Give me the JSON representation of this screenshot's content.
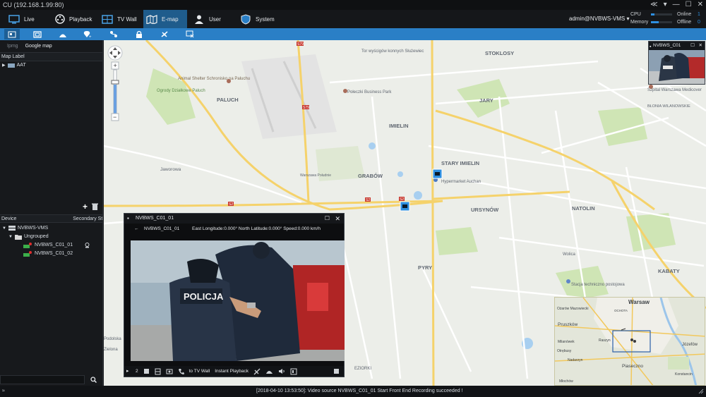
{
  "window": {
    "title": "CU (192.168.1.99:80)",
    "controls": [
      "≪",
      "▾",
      "—",
      "☐",
      "✕"
    ]
  },
  "nav": {
    "items": [
      {
        "label": "Live",
        "icon": "monitor-icon"
      },
      {
        "label": "Playback",
        "icon": "film-reel-icon"
      },
      {
        "label": "TV Wall",
        "icon": "grid-icon"
      },
      {
        "label": "E-map",
        "icon": "map-icon"
      },
      {
        "label": "User",
        "icon": "user-icon"
      },
      {
        "label": "System",
        "icon": "shield-icon"
      }
    ],
    "active": "E-map",
    "user": "admin@NVBWS-VMS ▾",
    "cpu_label": "CPU",
    "memory_label": "Memory",
    "online_label": "Online",
    "offline_label": "Offline",
    "online_count": "1",
    "offline_count": "0",
    "cpu_level": 0.15,
    "memory_level": 0.35
  },
  "toolbar": {
    "tools": [
      "layers-icon",
      "fullscreen-icon",
      "camera-dome-icon",
      "add-location-icon",
      "route-icon",
      "lock-icon",
      "satellite-icon",
      "clear-icon"
    ]
  },
  "left": {
    "tab_inactive": "Ipmg",
    "tab_active": "Google map",
    "map_label_header": "Map Label",
    "map_label_item": "AAT",
    "device_header": "Device",
    "secondary_header": "Secondary St",
    "tree": {
      "root": "NVBWS-VMS",
      "group": "Ungrouped",
      "devices": [
        "NVBWS_C01_01",
        "NVBWS_C01_02"
      ]
    }
  },
  "map": {
    "labels": {
      "stoklosy": "STOKLOSY",
      "jary": "JARY",
      "imielin": "IMIELIN",
      "stary_imielin": "STARY IMIELIN",
      "grabow": "GRABÓW",
      "ursynow": "URSYNÓW",
      "natolin": "NATOLIN",
      "kabaty": "KABATY",
      "paluch": "PALUCH",
      "jaworowa": "Jaworowa",
      "blonia": "BŁONIA WILANOWSKIE",
      "animal_shelter": "Animal Shelter Schronisko na Paluchu",
      "ogrody": "Ogrody Działkowe Paluch",
      "targowisko": "Tor wyścigów konnych Służewiec",
      "poleczki": "Połeczki Business Park",
      "hypermarket": "Hypermarket Auchan",
      "szpital": "Szpital Warszawa Medicover",
      "stacja": "Stacja techniczno postojowa",
      "podolska": "Podolska",
      "zielona": "Zielona",
      "ezioriki": "EZIORKI",
      "warszawa": "Warszawa Południe",
      "pyry": "PYRY",
      "wolica": "Wolica",
      "minimap_city": "Warsaw",
      "minimap_pruszkow": "Pruszków",
      "minimap_jozefow": "Józefów",
      "minimap_piaseczno": "Piaseczno",
      "minimap_otrebusy": "Otrębusy",
      "minimap_ozarow": "Ożarów Mazowiecki",
      "minimap_nadarzyn": "Nadarzyn",
      "minimap_mlochow": "Młochów",
      "minimap_raszyn": "Raszyn",
      "minimap_ochota": "OCHOTA",
      "minimap_milanowek": "Milanówek",
      "minimap_konstancin": "Konstancin"
    },
    "road_numbers": [
      "S79",
      "S79",
      "S2",
      "S2",
      "S2"
    ],
    "preview_title": "NVBWS_C01",
    "zoom_plus": "+",
    "zoom_minus": "−"
  },
  "video": {
    "window_title": "NVBWS_C01_01",
    "channel": "NVBWS_C01_01",
    "gps": "East Longitude:0.000° North Latitude:0.000° Speed:0.000 km/h",
    "to_tv_wall": "to TV Wall",
    "instant_playback": "Instant Playback",
    "stream": "2"
  },
  "status": {
    "message": "[2018-04-10 13:53:50]: Video source NVBWS_C01_01 Start Front End Recording succeeded !"
  },
  "colors": {
    "accent": "#2a7fc6",
    "nav_active": "#1f5c8c",
    "map_bg": "#eef0ec",
    "road_yellow": "#f5d26b",
    "device_red": "#e02d2d"
  }
}
